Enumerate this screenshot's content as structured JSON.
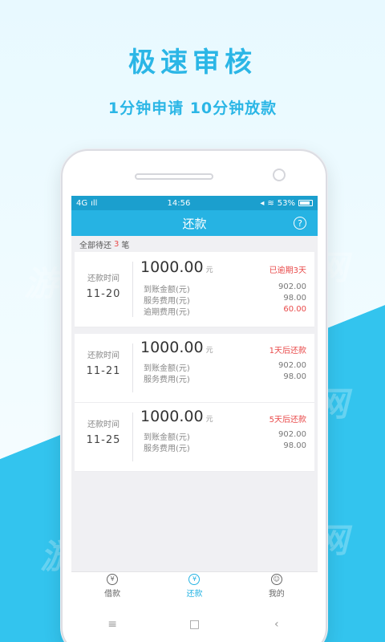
{
  "promo": {
    "title": "极速审核",
    "subtitle": "1分钟申请 10分钟放款",
    "watermark": "游园网"
  },
  "status_bar": {
    "signal": "4G",
    "time": "14:56",
    "battery": "53%"
  },
  "header": {
    "title": "还款",
    "help_icon": "?"
  },
  "summary": {
    "prefix": "全部待还",
    "count": "3",
    "suffix": "笔"
  },
  "repayments": [
    {
      "date_label": "还款时间",
      "date": "11-20",
      "amount": "1000.00",
      "unit": "元",
      "status": "已逾期3天",
      "details": [
        {
          "label": "到账金额(元)",
          "value": "902.00"
        },
        {
          "label": "服务费用(元)",
          "value": "98.00"
        },
        {
          "label": "逾期费用(元)",
          "value": "60.00"
        }
      ]
    },
    {
      "date_label": "还款时间",
      "date": "11-21",
      "amount": "1000.00",
      "unit": "元",
      "status": "1天后还款",
      "details": [
        {
          "label": "到账金额(元)",
          "value": "902.00"
        },
        {
          "label": "服务费用(元)",
          "value": "98.00"
        }
      ]
    },
    {
      "date_label": "还款时间",
      "date": "11-25",
      "amount": "1000.00",
      "unit": "元",
      "status": "5天后还款",
      "details": [
        {
          "label": "到账金额(元)",
          "value": "902.00"
        },
        {
          "label": "服务费用(元)",
          "value": "98.00"
        }
      ]
    }
  ],
  "tabs": [
    {
      "label": "借款",
      "icon": "money-bag-icon",
      "glyph": "¥"
    },
    {
      "label": "还款",
      "icon": "repay-icon",
      "glyph": "¥"
    },
    {
      "label": "我的",
      "icon": "user-icon",
      "glyph": "☺"
    }
  ],
  "nav": {
    "menu": "≡",
    "home": "□",
    "back": "‹"
  },
  "colors": {
    "brand": "#26b3e3",
    "statusbar": "#1b9fce",
    "alert": "#e94b4b",
    "background_diagonal": "#33c4ee"
  }
}
